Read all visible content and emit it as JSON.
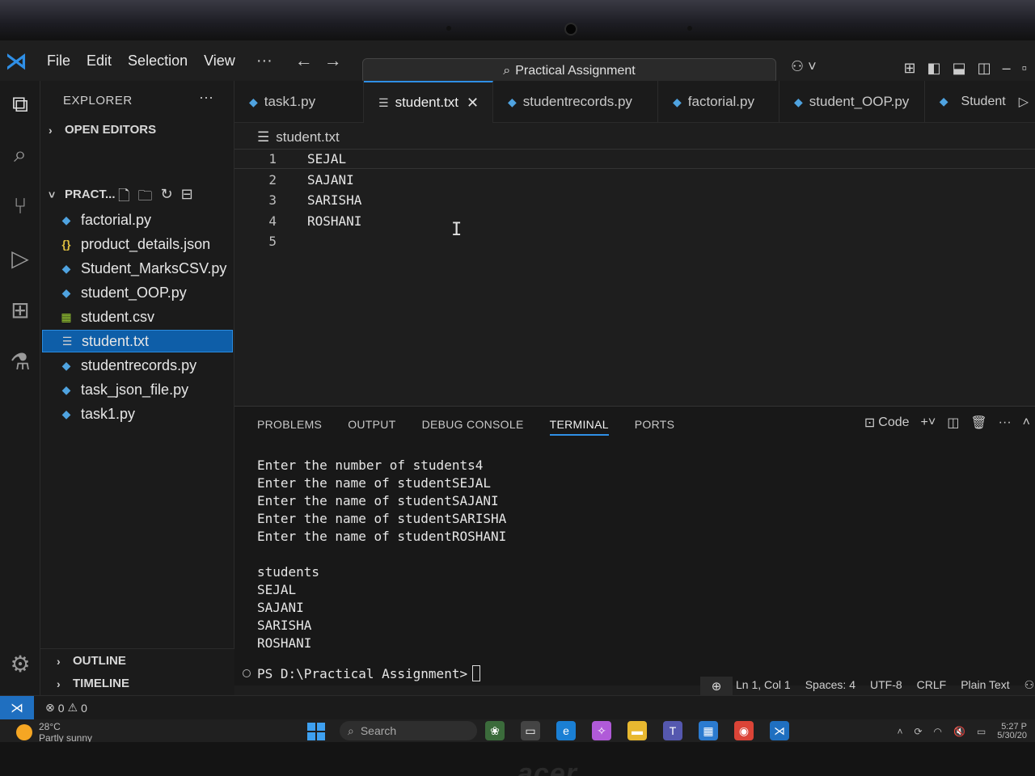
{
  "titlebar": {
    "menu": [
      "File",
      "Edit",
      "Selection",
      "View"
    ],
    "search_text": "Practical Assignment"
  },
  "sidebar": {
    "title": "EXPLORER",
    "open_editors": "OPEN EDITORS",
    "folder": "PRACT...",
    "files": [
      {
        "name": "factorial.py",
        "icon": "python-icon"
      },
      {
        "name": "product_details.json",
        "icon": "json-icon"
      },
      {
        "name": "Student_MarksCSV.py",
        "icon": "python-icon"
      },
      {
        "name": "student_OOP.py",
        "icon": "python-icon"
      },
      {
        "name": "student.csv",
        "icon": "csv-icon"
      },
      {
        "name": "student.txt",
        "icon": "text-file-icon"
      },
      {
        "name": "studentrecords.py",
        "icon": "python-icon"
      },
      {
        "name": "task_json_file.py",
        "icon": "python-icon"
      },
      {
        "name": "task1.py",
        "icon": "python-icon"
      }
    ],
    "outline": "OUTLINE",
    "timeline": "TIMELINE"
  },
  "tabs": [
    {
      "label": "task1.py"
    },
    {
      "label": "student.txt"
    },
    {
      "label": "studentrecords.py"
    },
    {
      "label": "factorial.py"
    },
    {
      "label": "student_OOP.py"
    }
  ],
  "tab_actions": {
    "run_label": "Student"
  },
  "breadcrumb": "student.txt",
  "editor": {
    "lines": [
      {
        "num": "1",
        "text": "SEJAL"
      },
      {
        "num": "2",
        "text": "SAJANI"
      },
      {
        "num": "3",
        "text": "SARISHA"
      },
      {
        "num": "4",
        "text": "ROSHANI"
      },
      {
        "num": "5",
        "text": ""
      }
    ]
  },
  "panel": {
    "tabs": [
      "PROBLEMS",
      "OUTPUT",
      "DEBUG CONSOLE",
      "TERMINAL",
      "PORTS"
    ],
    "active_tab": "TERMINAL",
    "shell_label": "Code",
    "terminal_lines": [
      "Enter the number of students4",
      "Enter the name of studentSEJAL",
      "Enter the name of studentSAJANI",
      "Enter the name of studentSARISHA",
      "Enter the name of studentROSHANI",
      "",
      "students",
      "SEJAL",
      "SAJANI",
      "SARISHA",
      "ROSHANI"
    ],
    "prompt": "PS D:\\Practical Assignment>"
  },
  "statusbar": {
    "errors": "0",
    "warnings": "0",
    "position": "Ln 1, Col 1",
    "spaces": "Spaces: 4",
    "encoding": "UTF-8",
    "eol": "CRLF",
    "language": "Plain Text"
  },
  "taskbar": {
    "temperature": "28°C",
    "weather": "Partly sunny",
    "search": "Search",
    "time": "5:27 P",
    "date": "5/30/20"
  },
  "colors": {
    "accent": "#2f8fe6",
    "selection": "#0e5ea8",
    "python": "#4fa3e0"
  },
  "bezel": {
    "brand": "acer"
  }
}
